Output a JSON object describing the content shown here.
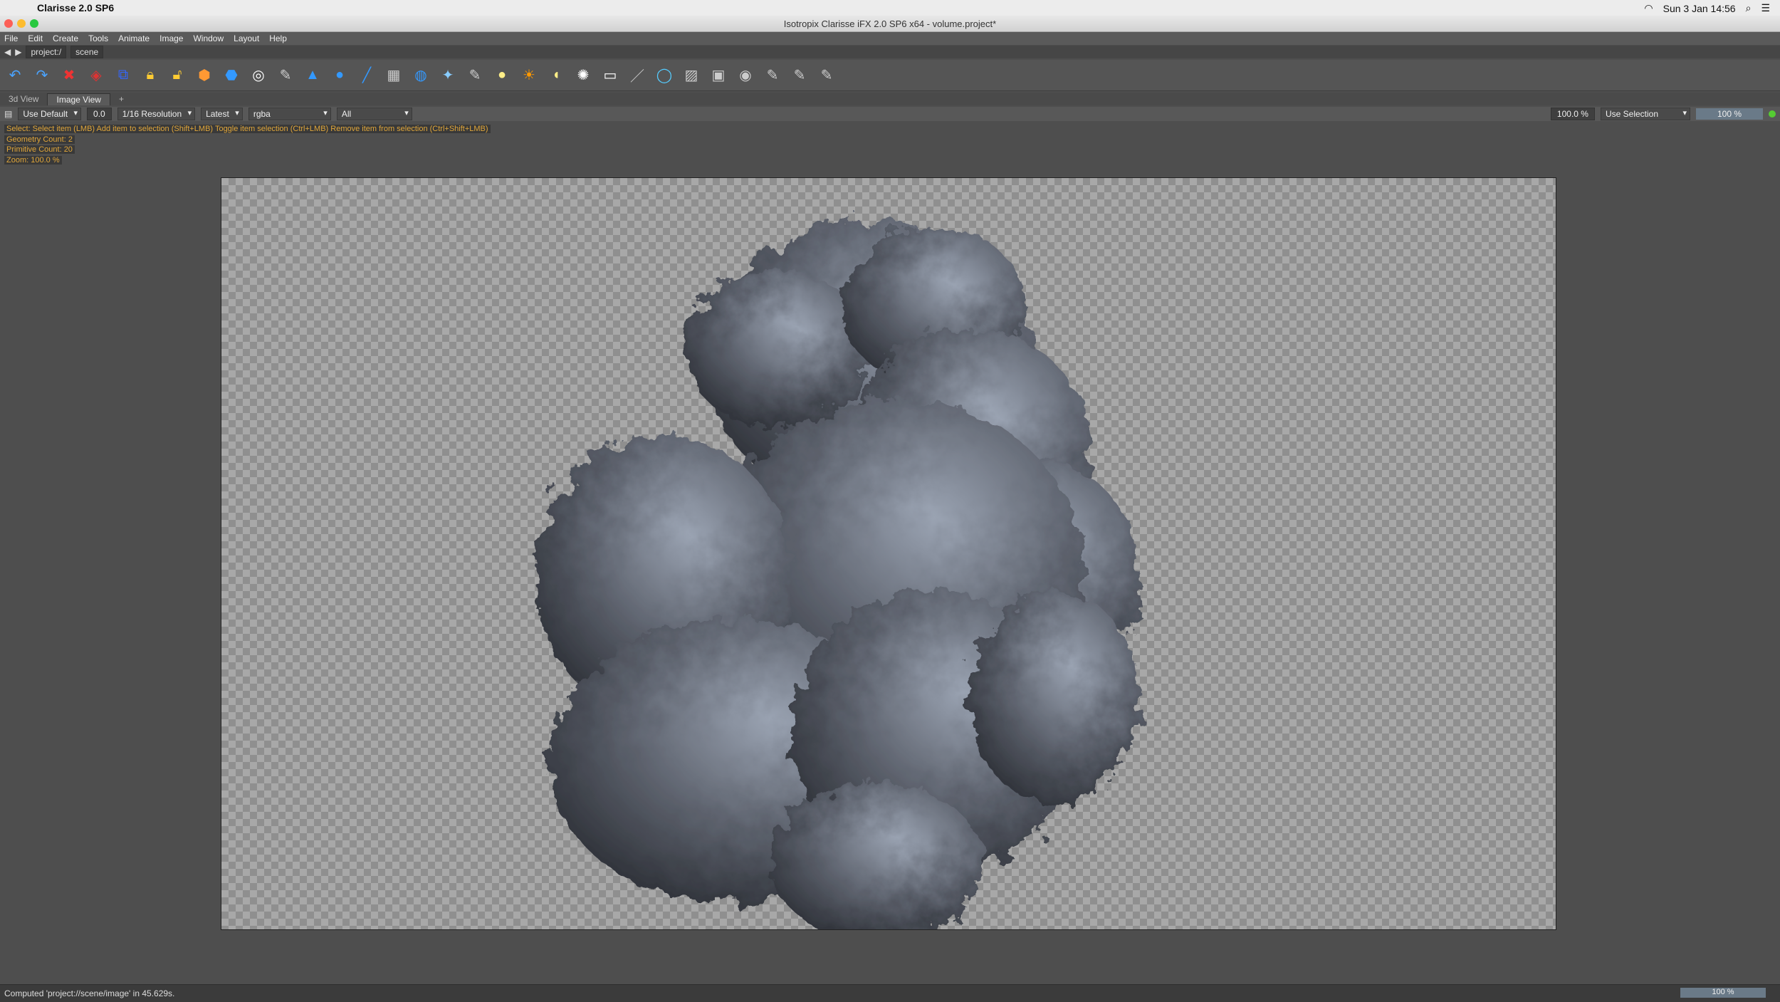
{
  "os_menubar": {
    "app_name": "Clarisse 2.0 SP6",
    "clock": "Sun 3 Jan 14:56"
  },
  "window": {
    "title": "Isotropix Clarisse iFX 2.0 SP6 x64  - volume.project*"
  },
  "menu": {
    "items": [
      "File",
      "Edit",
      "Create",
      "Tools",
      "Animate",
      "Image",
      "Window",
      "Layout",
      "Help"
    ]
  },
  "path": {
    "segments": [
      "project:/",
      "scene"
    ]
  },
  "tabs": [
    {
      "label": "3d View"
    },
    {
      "label": "Image View"
    }
  ],
  "view_options": {
    "display_mode": "Use Default",
    "time_value": "0.0",
    "resolution": "1/16 Resolution",
    "layer_mode": "Latest",
    "channel": "rgba",
    "filter": "All",
    "zoom_value": "100.0 %",
    "selection_mode": "Use Selection",
    "progress_label": "100 %"
  },
  "overlay": {
    "line1": "Select: Select item (LMB)  Add item to selection (Shift+LMB)  Toggle item selection (Ctrl+LMB)  Remove item from selection (Ctrl+Shift+LMB)",
    "line2": "Geometry Count: 2",
    "line3": "Primitive Count: 20",
    "line4": "Zoom: 100.0 %"
  },
  "status": {
    "message": "Computed 'project://scene/image' in 45.629s.",
    "progress_label": "100 %"
  }
}
